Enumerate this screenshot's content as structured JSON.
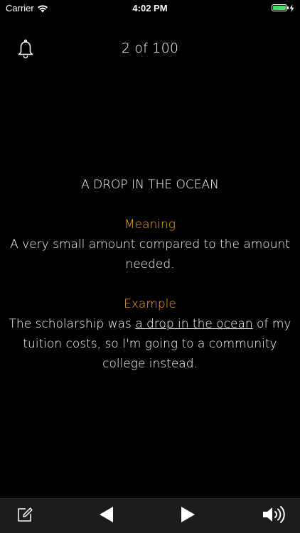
{
  "status_bar": {
    "carrier": "Carrier",
    "time": "4:02 PM",
    "battery_level": 1.0,
    "battery_color": "#4cd964"
  },
  "header": {
    "counter": "2 of 100",
    "bell_icon": "bell-icon"
  },
  "card": {
    "idiom": "A DROP IN THE OCEAN",
    "meaning_heading": "Meaning",
    "meaning_text": "A very small amount compared to the amount needed.",
    "example_heading": "Example",
    "example_before": "The scholarship was ",
    "example_highlight": "a drop in the ocean",
    "example_after": " of my tuition costs, so I'm going to a community college instead."
  },
  "toolbar": {
    "edit_icon": "edit-icon",
    "prev_icon": "previous-icon",
    "next_icon": "next-icon",
    "sound_icon": "speaker-icon"
  },
  "colors": {
    "background": "#000000",
    "accent": "#f5a623",
    "toolbar": "#1c1c1c"
  }
}
